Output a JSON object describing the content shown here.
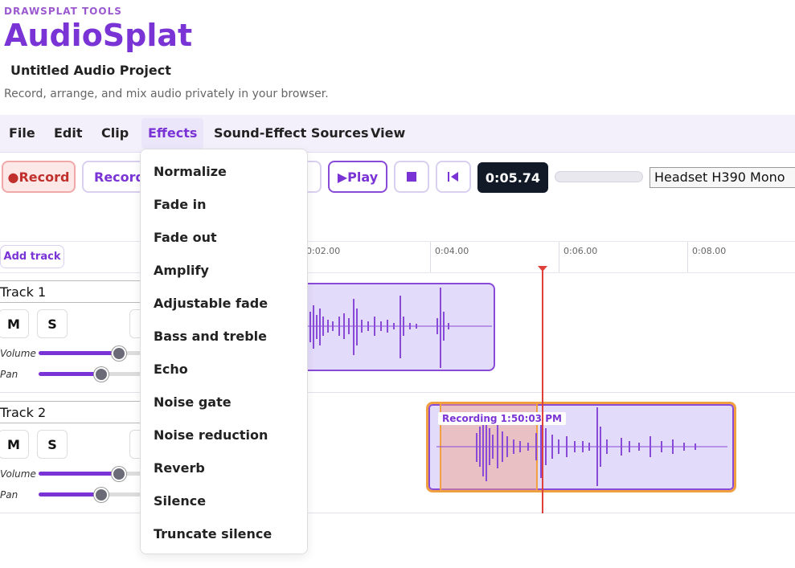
{
  "app": {
    "brand_small": "DRAWSPLAT TOOLS",
    "brand": "AudioSplat",
    "project_title": "Untitled Audio Project",
    "tagline": "Record, arrange, and mix audio privately in your browser."
  },
  "menubar": {
    "items": [
      {
        "label": "File"
      },
      {
        "label": "Edit"
      },
      {
        "label": "Clip"
      },
      {
        "label": "Effects",
        "active": true
      },
      {
        "label": "Sound-Effect Sources"
      },
      {
        "label": "View"
      }
    ]
  },
  "toolbar": {
    "record_label": "●Record",
    "record2_label": "Record",
    "play_label": "▶Play",
    "stop_icon": "stop-icon",
    "rewind_icon": "rewind-to-start-icon",
    "time": "0:05.74",
    "input_device": "Headset H390 Mono"
  },
  "timeline": {
    "add_track_label": "Add track",
    "ruler_labels": [
      "0:02.00",
      "0:04.00",
      "0:06.00",
      "0:08.00"
    ],
    "playhead_time": "0:05.74"
  },
  "tracks": [
    {
      "name": "Track 1",
      "mute_label": "M",
      "solo_label": "S",
      "volume_label": "Volume",
      "pan_label": "Pan",
      "volume_level": 0.78,
      "pan_level": 0.5
    },
    {
      "name": "Track 2",
      "mute_label": "M",
      "solo_label": "S",
      "volume_label": "Volume",
      "pan_label": "Pan",
      "volume_level": 0.78,
      "pan_level": 0.5,
      "clip_label": "Recording 1:50:03 PM"
    }
  ],
  "effects_menu": {
    "items": [
      "Normalize",
      "Fade in",
      "Fade out",
      "Amplify",
      "Adjustable fade",
      "Bass and treble",
      "Echo",
      "Noise gate",
      "Noise reduction",
      "Reverb",
      "Silence",
      "Truncate silence"
    ]
  },
  "colors": {
    "accent": "#7a34d6",
    "record": "#c0302c",
    "playhead": "#e0403a",
    "selection": "#f0a040"
  }
}
